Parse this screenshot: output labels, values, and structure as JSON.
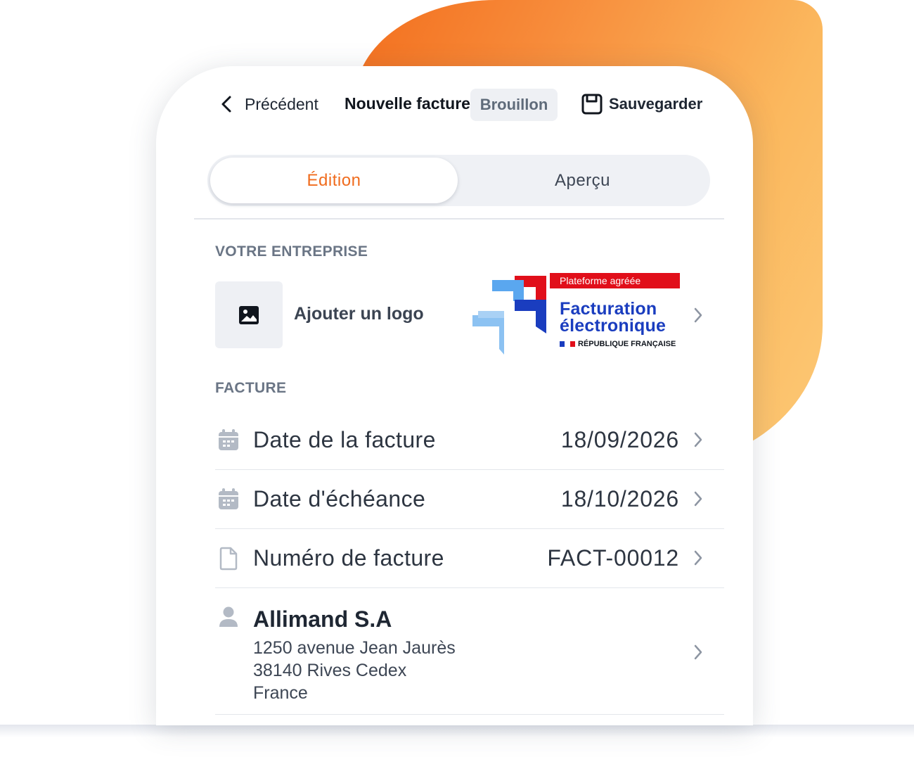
{
  "header": {
    "back_label": "Précédent",
    "title": "Nouvelle facture",
    "status_badge": "Brouillon",
    "save_label": "Sauvegarder"
  },
  "tabs": [
    {
      "label": "Édition",
      "active": true
    },
    {
      "label": "Aperçu",
      "active": false
    }
  ],
  "company": {
    "section_title": "VOTRE ENTREPRISE",
    "add_logo_label": "Ajouter un logo",
    "certification": {
      "banner": "Plateforme agréée",
      "line1": "Facturation",
      "line2": "électronique",
      "authority": "RÉPUBLIQUE FRANÇAISE"
    }
  },
  "invoice": {
    "section_title": "FACTURE",
    "rows": [
      {
        "icon": "calendar-icon",
        "label": "Date de la facture",
        "value": "18/09/2026"
      },
      {
        "icon": "calendar-icon",
        "label": "Date d'échéance",
        "value": "18/10/2026"
      },
      {
        "icon": "document-icon",
        "label": "Numéro de facture",
        "value": "FACT-00012"
      }
    ]
  },
  "client": {
    "icon": "user-icon",
    "name": "Allimand S.A",
    "address_line1": "1250 avenue Jean Jaurès",
    "address_line2": "38140 Rives Cedex",
    "country": "France"
  },
  "colors": {
    "accent": "#f06c1e",
    "brand_blue": "#1a3dbf",
    "brand_red": "#e10f1a"
  }
}
